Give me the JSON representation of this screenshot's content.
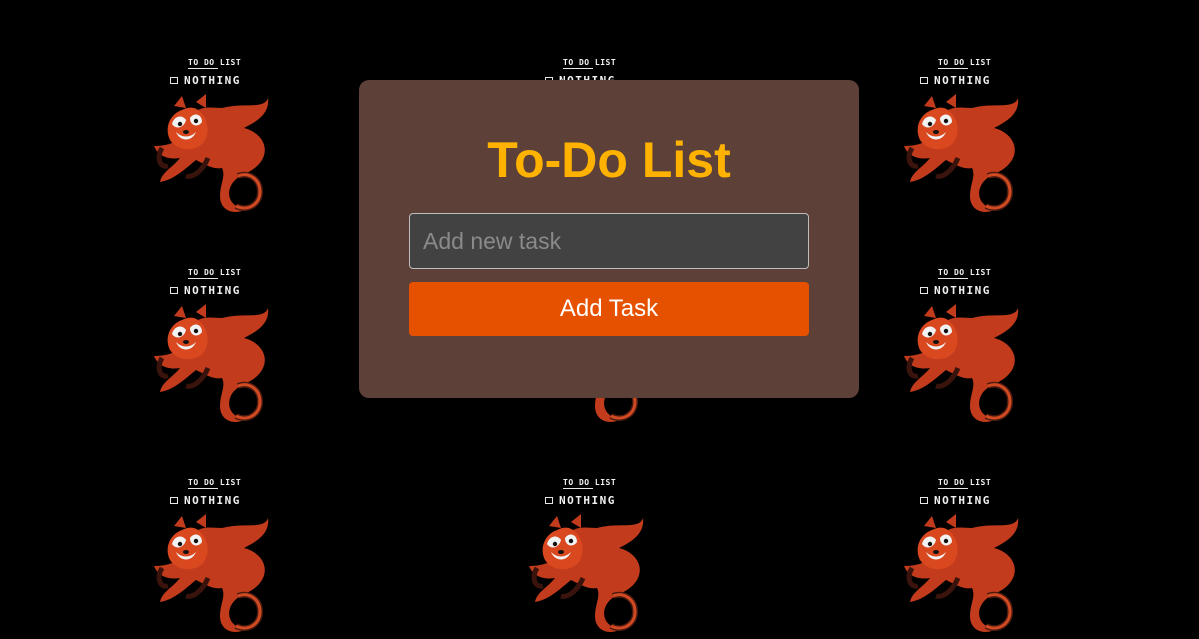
{
  "background": {
    "tile_title": "TO DO LIST",
    "tile_item": "NOTHING",
    "tile_icon": "red-panda-illustration"
  },
  "card": {
    "title": "To-Do List",
    "input_placeholder": "Add new task",
    "input_value": "",
    "add_button_label": "Add Task"
  },
  "colors": {
    "page_background": "#000000",
    "card_background": "#5d4037",
    "title_color": "#ffb300",
    "input_background": "#424242",
    "button_background": "#e65100",
    "button_text": "#ffffff"
  }
}
